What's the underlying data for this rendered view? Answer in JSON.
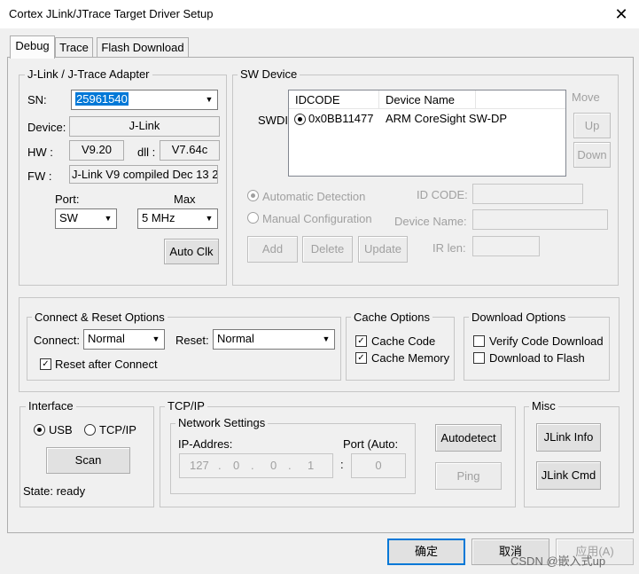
{
  "window": {
    "title": "Cortex JLink/JTrace Target Driver Setup",
    "close_glyph": "✕"
  },
  "tabs": [
    "Debug",
    "Trace",
    "Flash Download"
  ],
  "adapter": {
    "group_label": "J-Link / J-Trace Adapter",
    "sn_label": "SN:",
    "sn_value": "25961540",
    "device_label": "Device:",
    "device_value": "J-Link",
    "hw_label": "HW :",
    "hw_value": "V9.20",
    "dll_label": "dll :",
    "dll_value": "V7.64c",
    "fw_label": "FW :",
    "fw_value": "J-Link V9 compiled Dec 13 2",
    "port_label": "Port:",
    "port_value": "SW",
    "max_label": "Max",
    "max_value": "5 MHz",
    "auto_clk": "Auto Clk"
  },
  "sw_device": {
    "group_label": "SW Device",
    "swdi_label": "SWDI",
    "col_idcode": "IDCODE",
    "col_device": "Device Name",
    "row": {
      "idcode": "0x0BB11477",
      "device": "ARM CoreSight SW-DP"
    },
    "move_label": "Move",
    "up": "Up",
    "down": "Down",
    "auto_detect": "Automatic Detection",
    "manual_config": "Manual Configuration",
    "id_code_label": "ID CODE:",
    "device_name_label": "Device Name:",
    "ir_len_label": "IR len:",
    "add": "Add",
    "delete": "Delete",
    "update": "Update"
  },
  "connect_reset": {
    "group_label": "Connect & Reset Options",
    "connect_label": "Connect:",
    "connect_value": "Normal",
    "reset_label": "Reset:",
    "reset_value": "Normal",
    "reset_after_connect": "Reset after Connect"
  },
  "cache": {
    "group_label": "Cache Options",
    "cache_code": "Cache Code",
    "cache_memory": "Cache Memory"
  },
  "download": {
    "group_label": "Download Options",
    "verify": "Verify Code Download",
    "to_flash": "Download to Flash"
  },
  "interface": {
    "group_label": "Interface",
    "usb": "USB",
    "tcpip": "TCP/IP",
    "scan": "Scan",
    "state": "State: ready"
  },
  "tcpip": {
    "group_label": "TCP/IP",
    "network_label": "Network Settings",
    "ip_label": "IP-Addres:",
    "ip": [
      "127",
      "0",
      "0",
      "1"
    ],
    "port_label": "Port (Auto:",
    "port_value": "0",
    "autodetect": "Autodetect",
    "ping": "Ping"
  },
  "misc": {
    "group_label": "Misc",
    "jlink_info": "JLink Info",
    "jlink_cmd": "JLink Cmd"
  },
  "footer": {
    "ok": "确定",
    "cancel": "取消",
    "apply": "应用(A)",
    "watermark": "CSDN @嵌入式up"
  },
  "colors": {
    "accent": "#0078d7",
    "dialog_bg": "#f0f0f0",
    "disabled_text": "#a0a0a0"
  },
  "icons": {
    "combo_arrow": "▼",
    "check": "✓"
  }
}
